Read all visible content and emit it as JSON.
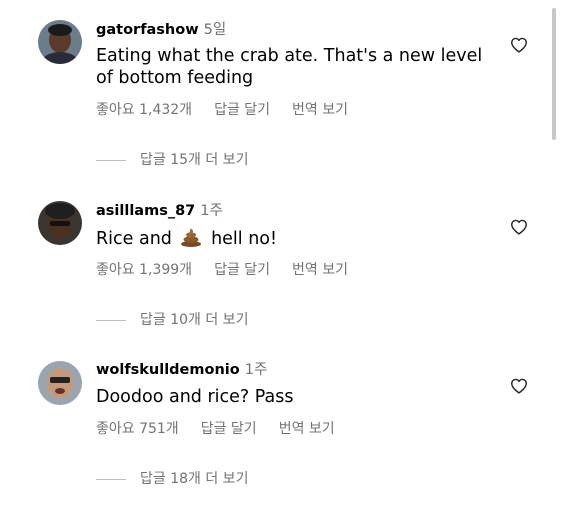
{
  "comments": [
    {
      "username": "gatorfashow",
      "time": "5일",
      "text": "Eating what the crab ate. That's a new level of bottom feeding",
      "likes": "좋아요 1,432개",
      "reply": "답글 달기",
      "translate": "번역 보기",
      "view_replies": "답글 15개 더 보기"
    },
    {
      "username": "asilllams_87",
      "time": "1주",
      "text_before": "Rice and",
      "emoji": "poop-emoji",
      "text_after": "hell no!",
      "likes": "좋아요 1,399개",
      "reply": "답글 달기",
      "translate": "번역 보기",
      "view_replies": "답글 10개 더 보기"
    },
    {
      "username": "wolfskulldemonio",
      "time": "1주",
      "text": "Doodoo and rice? Pass",
      "likes": "좋아요 751개",
      "reply": "답글 달기",
      "translate": "번역 보기",
      "view_replies": "답글 18개 더 보기"
    }
  ],
  "icons": {
    "like": "heart-outline-icon"
  },
  "colors": {
    "secondary_text": "#737373",
    "primary_text": "#000000",
    "background": "#ffffff"
  }
}
